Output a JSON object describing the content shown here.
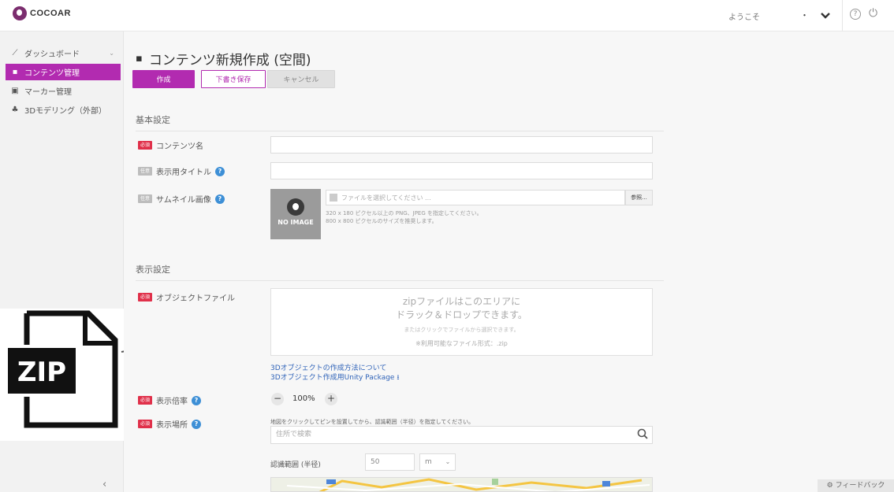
{
  "header": {
    "logo_text": "COCOAR",
    "welcome": "ようこそ",
    "user_menu": "・",
    "help_icon": "?",
    "power_icon": "⏻"
  },
  "sidebar": {
    "items": [
      {
        "label": "ダッシュボード",
        "icon": "chart-icon",
        "glyph": "⟋"
      },
      {
        "label": "コンテンツ管理",
        "icon": "content-icon",
        "glyph": "▪"
      },
      {
        "label": "マーカー管理",
        "icon": "image-icon",
        "glyph": "▣"
      },
      {
        "label": "3Dモデリング（外部）",
        "icon": "person-icon",
        "glyph": "♣"
      }
    ],
    "collapse": "‹"
  },
  "page": {
    "title": "コンテンツ新規作成 (空間)",
    "buttons": {
      "create": "作成",
      "draft": "下書き保存",
      "cancel": "キャンセル"
    }
  },
  "basic_settings": {
    "title": "基本設定",
    "content_name": {
      "badge": "必須",
      "label": "コンテンツ名"
    },
    "display_title": {
      "badge": "任意",
      "label": "表示用タイトル"
    },
    "thumbnail": {
      "badge": "任意",
      "label": "サムネイル画像",
      "noimage": "NO IMAGE",
      "file_placeholder": "ファイルを選択してください ...",
      "browse": "参照...",
      "hint1": "320 x 180 ピクセル以上の PNG、JPEG を指定してください。",
      "hint2": "800 x 800 ピクセルのサイズを推奨します。"
    }
  },
  "display_settings": {
    "title": "表示設定",
    "object_file": {
      "badge": "必須",
      "label": "オブジェクトファイル",
      "drop_line1": "zipファイルはこのエリアに",
      "drop_line2": "ドラック＆ドロップできます。",
      "drop_sub": "またはクリックでファイルから選択できます。",
      "drop_formats": "※利用可能なファイル形式：.zip",
      "link1": "3Dオブジェクトの作成方法について",
      "link2": "3Dオブジェクト作成用Unity Package"
    },
    "scale": {
      "badge": "必須",
      "label": "表示倍率",
      "value": "100%",
      "minus": "−",
      "plus": "+"
    },
    "location": {
      "badge": "必須",
      "label": "表示場所",
      "hint": "地図をクリックしてピンを設置してから、認識範囲（半径）を指定してください。",
      "search_placeholder": "住所で検索",
      "range_label": "認識範囲 (半径)",
      "range_value": "50",
      "unit": "m"
    }
  },
  "overlay": {
    "zip_label": "ZIP"
  },
  "feedback": "フィードバック",
  "colors": {
    "accent": "#b22bb0",
    "required": "#e0304a",
    "link": "#2e62b8"
  }
}
